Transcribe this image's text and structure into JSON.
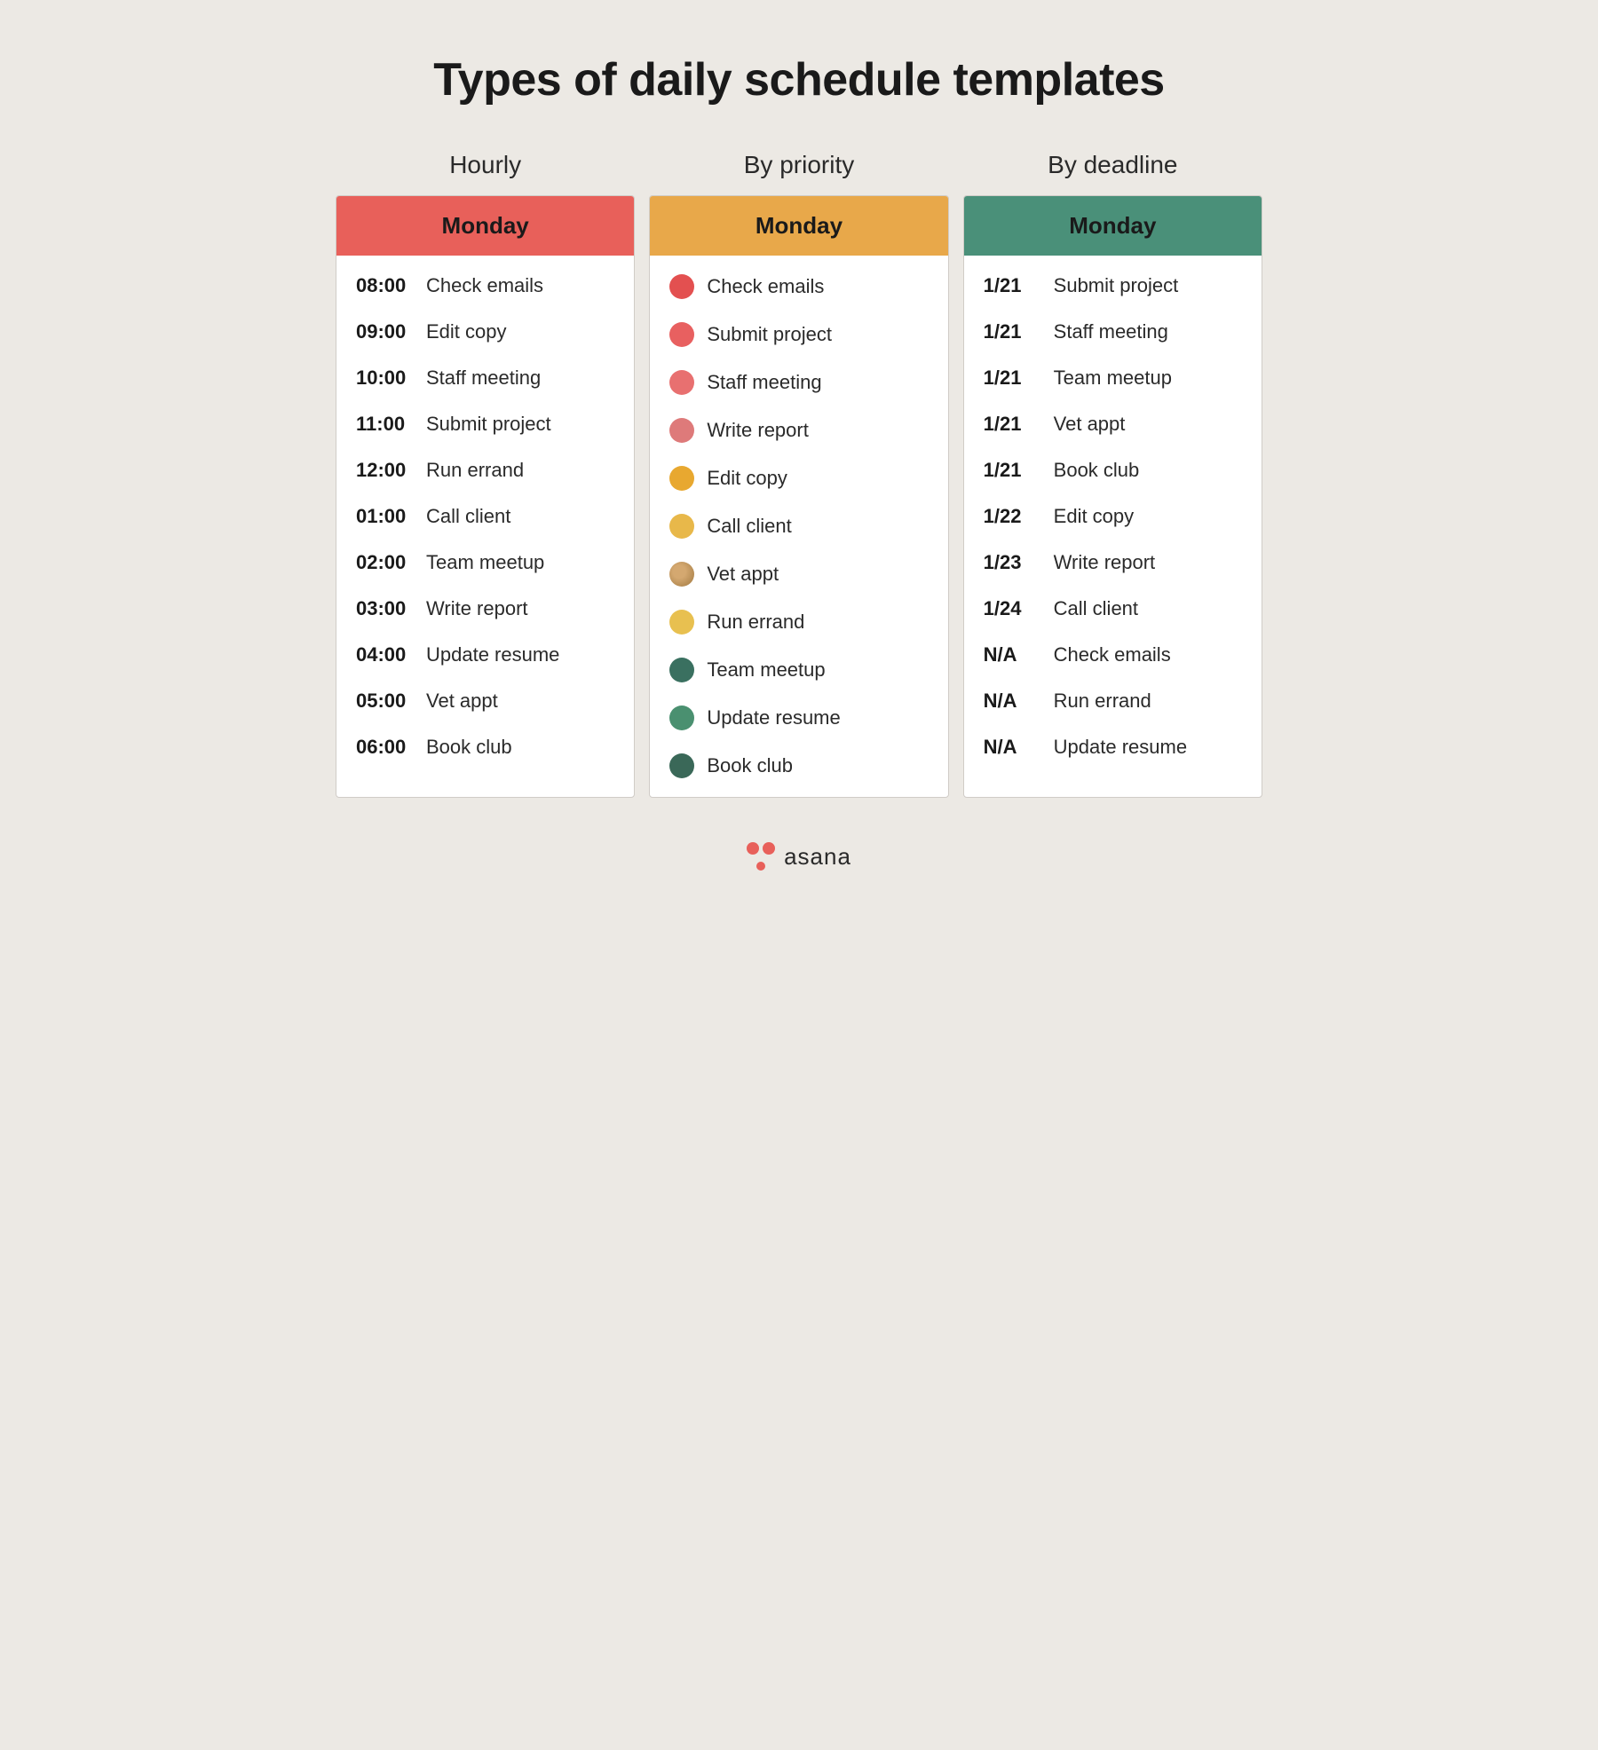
{
  "title": "Types of daily schedule templates",
  "columns": [
    {
      "header_label": "Hourly",
      "day_label": "Monday",
      "color": "red",
      "items": [
        {
          "prefix": "08:00",
          "label": "Check emails"
        },
        {
          "prefix": "09:00",
          "label": "Edit copy"
        },
        {
          "prefix": "10:00",
          "label": "Staff meeting"
        },
        {
          "prefix": "11:00",
          "label": "Submit project"
        },
        {
          "prefix": "12:00",
          "label": "Run errand"
        },
        {
          "prefix": "01:00",
          "label": "Call client"
        },
        {
          "prefix": "02:00",
          "label": "Team meetup"
        },
        {
          "prefix": "03:00",
          "label": "Write report"
        },
        {
          "prefix": "04:00",
          "label": "Update resume"
        },
        {
          "prefix": "05:00",
          "label": "Vet appt"
        },
        {
          "prefix": "06:00",
          "label": "Book club"
        }
      ]
    },
    {
      "header_label": "By priority",
      "day_label": "Monday",
      "color": "orange",
      "items": [
        {
          "prefix": "dot-red-high",
          "label": "Check emails"
        },
        {
          "prefix": "dot-red-med",
          "label": "Submit project"
        },
        {
          "prefix": "dot-red-low",
          "label": "Staff meeting"
        },
        {
          "prefix": "dot-red-faded",
          "label": "Write report"
        },
        {
          "prefix": "dot-orange-high",
          "label": "Edit copy"
        },
        {
          "prefix": "dot-orange-med",
          "label": "Call client"
        },
        {
          "prefix": "dot-tan",
          "label": "Vet appt"
        },
        {
          "prefix": "dot-yellow",
          "label": "Run errand"
        },
        {
          "prefix": "dot-teal-dark",
          "label": "Team meetup"
        },
        {
          "prefix": "dot-teal",
          "label": "Update resume"
        },
        {
          "prefix": "dot-teal-darker",
          "label": "Book club"
        }
      ]
    },
    {
      "header_label": "By deadline",
      "day_label": "Monday",
      "color": "green",
      "items": [
        {
          "prefix": "1/21",
          "label": "Submit project"
        },
        {
          "prefix": "1/21",
          "label": "Staff meeting"
        },
        {
          "prefix": "1/21",
          "label": "Team meetup"
        },
        {
          "prefix": "1/21",
          "label": "Vet appt"
        },
        {
          "prefix": "1/21",
          "label": "Book club"
        },
        {
          "prefix": "1/22",
          "label": "Edit copy"
        },
        {
          "prefix": "1/23",
          "label": "Write report"
        },
        {
          "prefix": "1/24",
          "label": "Call client"
        },
        {
          "prefix": "N/A",
          "label": "Check emails"
        },
        {
          "prefix": "N/A",
          "label": "Run errand"
        },
        {
          "prefix": "N/A",
          "label": "Update resume"
        }
      ]
    }
  ],
  "footer": {
    "brand": "asana"
  }
}
